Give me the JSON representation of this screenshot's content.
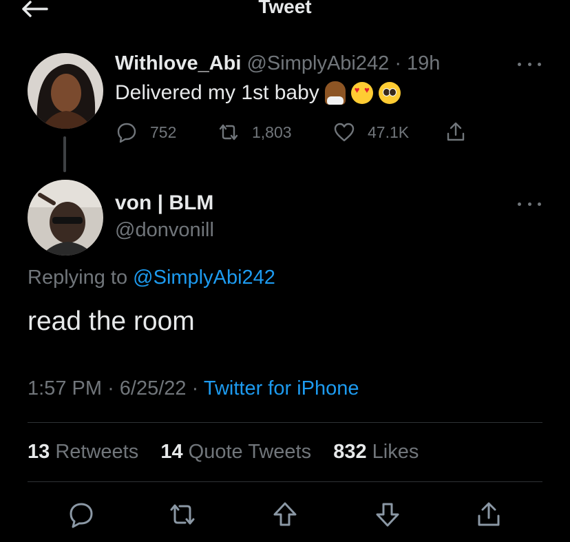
{
  "header": {
    "title": "Tweet"
  },
  "original_tweet": {
    "display_name": "Withlove_Abi",
    "handle": "@SimplyAbi242",
    "separator": "·",
    "age": "19h",
    "text": "Delivered my 1st baby",
    "emojis": [
      "woman-health-worker-emoji",
      "heart-eyes-emoji",
      "pleading-face-emoji"
    ],
    "replies": "752",
    "retweets": "1,803",
    "likes": "47.1K"
  },
  "reply_tweet": {
    "display_name": "von | BLM",
    "handle": "@donvonill",
    "replying_label": "Replying to",
    "replying_to": "@SimplyAbi242",
    "text": "read the room",
    "time": "1:57 PM",
    "date": "6/25/22",
    "source": "Twitter for iPhone"
  },
  "stats": {
    "retweets_count": "13",
    "retweets_label": "Retweets",
    "quotes_count": "14",
    "quotes_label": "Quote Tweets",
    "likes_count": "832",
    "likes_label": "Likes"
  },
  "colors": {
    "background": "#000000",
    "text": "#e7e9ea",
    "muted": "#71767b",
    "link": "#1d9bf0"
  }
}
